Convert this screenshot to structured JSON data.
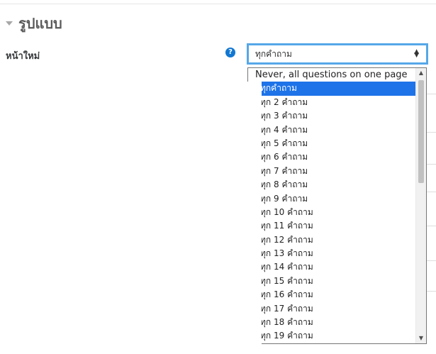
{
  "section": {
    "title": "รูปแบบ"
  },
  "field": {
    "label": "หน้าใหม่",
    "help_icon_glyph": "?"
  },
  "select": {
    "current_value": "ทุกคำถาม",
    "arrows_up": "▲",
    "arrows_down": "▼"
  },
  "dropdown": {
    "options": [
      "Never, all questions on one page",
      "ทุกคำถาม",
      "ทุก 2 คำถาม",
      "ทุก 3 คำถาม",
      "ทุก 4 คำถาม",
      "ทุก 5 คำถาม",
      "ทุก 6 คำถาม",
      "ทุก 7 คำถาม",
      "ทุก 8 คำถาม",
      "ทุก 9 คำถาม",
      "ทุก 10 คำถาม",
      "ทุก 11 คำถาม",
      "ทุก 12 คำถาม",
      "ทุก 13 คำถาม",
      "ทุก 14 คำถาม",
      "ทุก 15 คำถาม",
      "ทุก 16 คำถาม",
      "ทุก 17 คำถาม",
      "ทุก 18 คำถาม",
      "ทุก 19 คำถาม"
    ],
    "selected_index": 1,
    "scroll_up_glyph": "▲",
    "scroll_down_glyph": "▼"
  },
  "colors": {
    "accent": "#56a7e8",
    "selected": "#1e73e8",
    "help": "#1177d1"
  }
}
